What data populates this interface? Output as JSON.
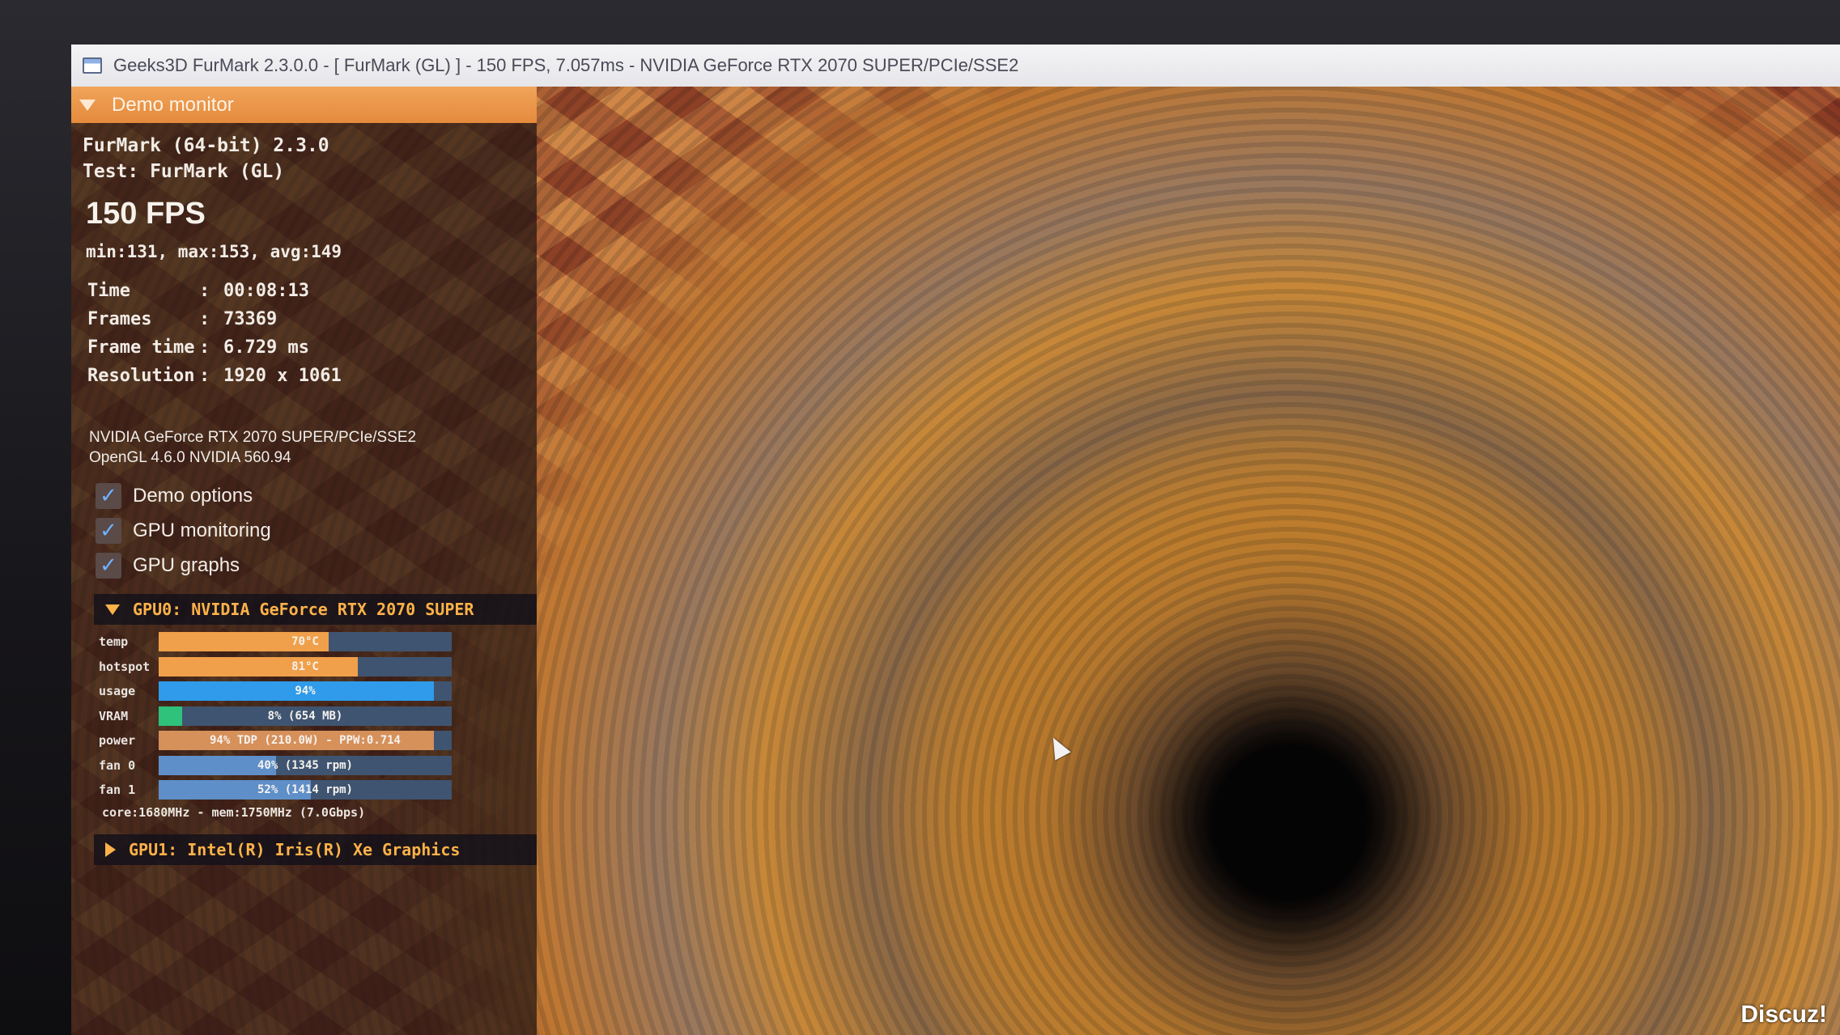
{
  "window": {
    "title": "Geeks3D FurMark 2.3.0.0 - [ FurMark (GL) ] - 150 FPS, 7.057ms - NVIDIA GeForce RTX 2070 SUPER/PCIe/SSE2"
  },
  "panel": {
    "header": "Demo monitor",
    "app_line": "FurMark (64-bit) 2.3.0",
    "test_line": "Test: FurMark (GL)",
    "fps": "150 FPS",
    "fps_stats": "min:131, max:153, avg:149",
    "stats": [
      {
        "label": "Time",
        "value": "00:08:13"
      },
      {
        "label": "Frames",
        "value": "73369"
      },
      {
        "label": "Frame time",
        "value": "6.729 ms"
      },
      {
        "label": "Resolution",
        "value": "1920 x 1061"
      }
    ],
    "renderer": "NVIDIA GeForce RTX 2070 SUPER/PCIe/SSE2",
    "opengl": "OpenGL 4.6.0 NVIDIA 560.94",
    "options": [
      {
        "label": "Demo options",
        "checked": true
      },
      {
        "label": "GPU monitoring",
        "checked": true
      },
      {
        "label": "GPU graphs",
        "checked": true
      }
    ]
  },
  "gpu0": {
    "title": "GPU0: NVIDIA GeForce RTX 2070 SUPER",
    "metrics": [
      {
        "label": "temp",
        "text": "70°C",
        "fill": 0.58,
        "color": "#f0a04a"
      },
      {
        "label": "hotspot",
        "text": "81°C",
        "fill": 0.68,
        "color": "#f0a04a"
      },
      {
        "label": "usage",
        "text": "94%",
        "fill": 0.94,
        "color": "#2f9bea"
      },
      {
        "label": "VRAM",
        "text": "8% (654 MB)",
        "fill": 0.08,
        "color": "#2ec27a"
      },
      {
        "label": "power",
        "text": "94% TDP (210.0W) - PPW:0.714",
        "fill": 0.94,
        "color": "#d6905a"
      },
      {
        "label": "fan 0",
        "text": "40% (1345 rpm)",
        "fill": 0.4,
        "color": "#5f8fc8"
      },
      {
        "label": "fan 1",
        "text": "52% (1414 rpm)",
        "fill": 0.52,
        "color": "#5f8fc8"
      }
    ],
    "clocks": "core:1680MHz - mem:1750MHz (7.0Gbps)"
  },
  "gpu1": {
    "title": "GPU1: Intel(R) Iris(R) Xe Graphics"
  },
  "watermark": "Discuz!"
}
